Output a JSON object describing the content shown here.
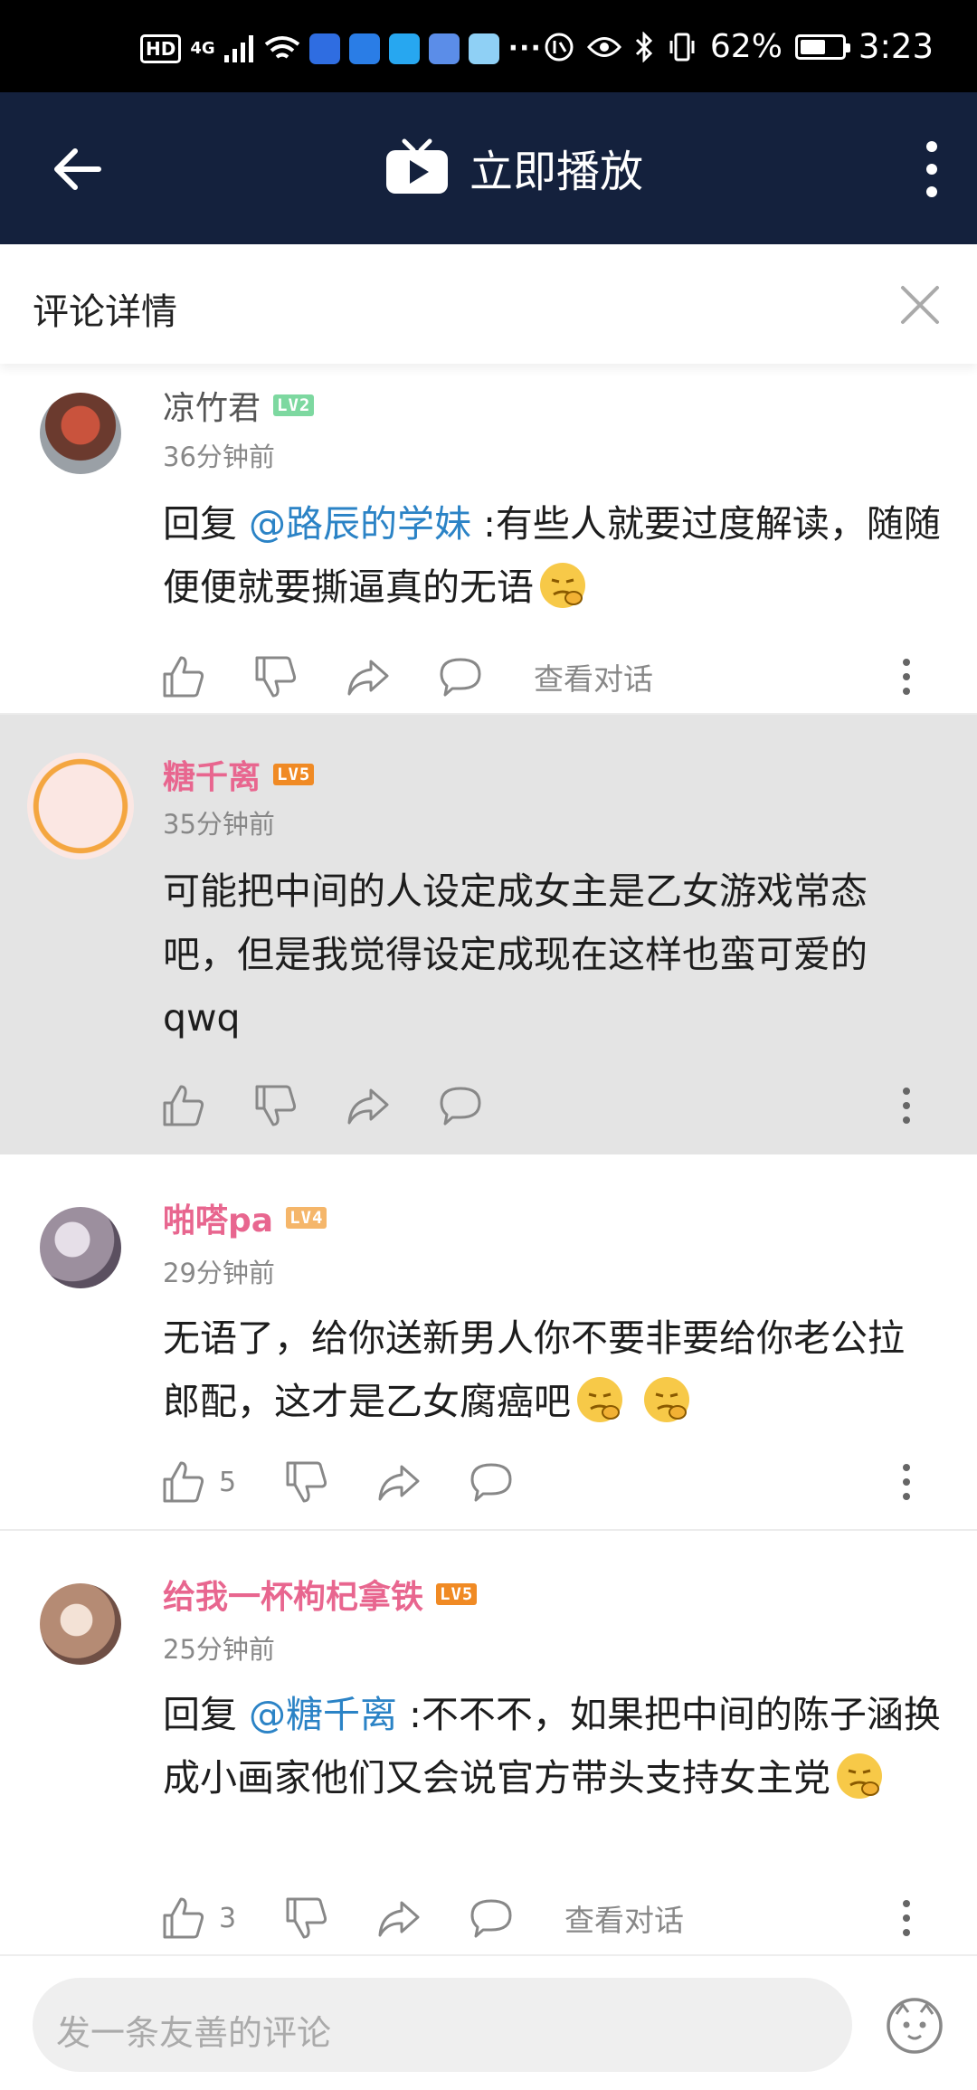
{
  "status_bar": {
    "tags": [
      "HD"
    ],
    "signal": "4G",
    "more": "···",
    "battery_percent": "62%",
    "battery_level": 0.62,
    "time": "3:23"
  },
  "top_bar": {
    "title": "立即播放"
  },
  "header": {
    "title": "评论详情"
  },
  "comments": [
    {
      "username": "凉竹君",
      "level": "LV2",
      "level_color": "#7dd8a0",
      "name_color": "#555555",
      "time": "36分钟前",
      "reply_prefix": "回复 ",
      "mention": "@路辰的学妹",
      "text": " :有些人就要过度解读，随随便便就要撕逼真的无语",
      "like_count": "",
      "view_conversation": "查看对话"
    },
    {
      "username": "糖千离",
      "level": "LV5",
      "level_color": "#f08a24",
      "name_color": "#e8668f",
      "time": "35分钟前",
      "text": "可能把中间的人设定成女主是乙女游戏常态吧，但是我觉得设定成现在这样也蛮可爱的qwq",
      "like_count": ""
    },
    {
      "username": "啪嗒pa",
      "level": "LV4",
      "level_color": "#f5b66a",
      "name_color": "#e8668f",
      "time": "29分钟前",
      "text": "无语了，给你送新男人你不要非要给你老公拉郎配，这才是乙女腐癌吧",
      "like_count": "5"
    },
    {
      "username": "给我一杯枸杞拿铁",
      "level": "LV5",
      "level_color": "#f08a24",
      "name_color": "#e8668f",
      "time": "25分钟前",
      "reply_prefix": "回复 ",
      "mention": "@糖千离",
      "text": " :不不不，如果把中间的陈子涵换成小画家他们又会说官方带头支持女主党",
      "like_count": "3",
      "view_conversation": "查看对话"
    }
  ],
  "input": {
    "placeholder": "发一条友善的评论"
  },
  "colors": {
    "nav_bg": "#14213d",
    "mention": "#2b83c6",
    "highlight_bg": "#e4e4e4"
  },
  "icons": [
    "back-arrow-icon",
    "tv-play-icon",
    "more-vertical-icon",
    "close-icon",
    "like-icon",
    "dislike-icon",
    "share-icon",
    "reply-icon",
    "emoji-icon"
  ]
}
